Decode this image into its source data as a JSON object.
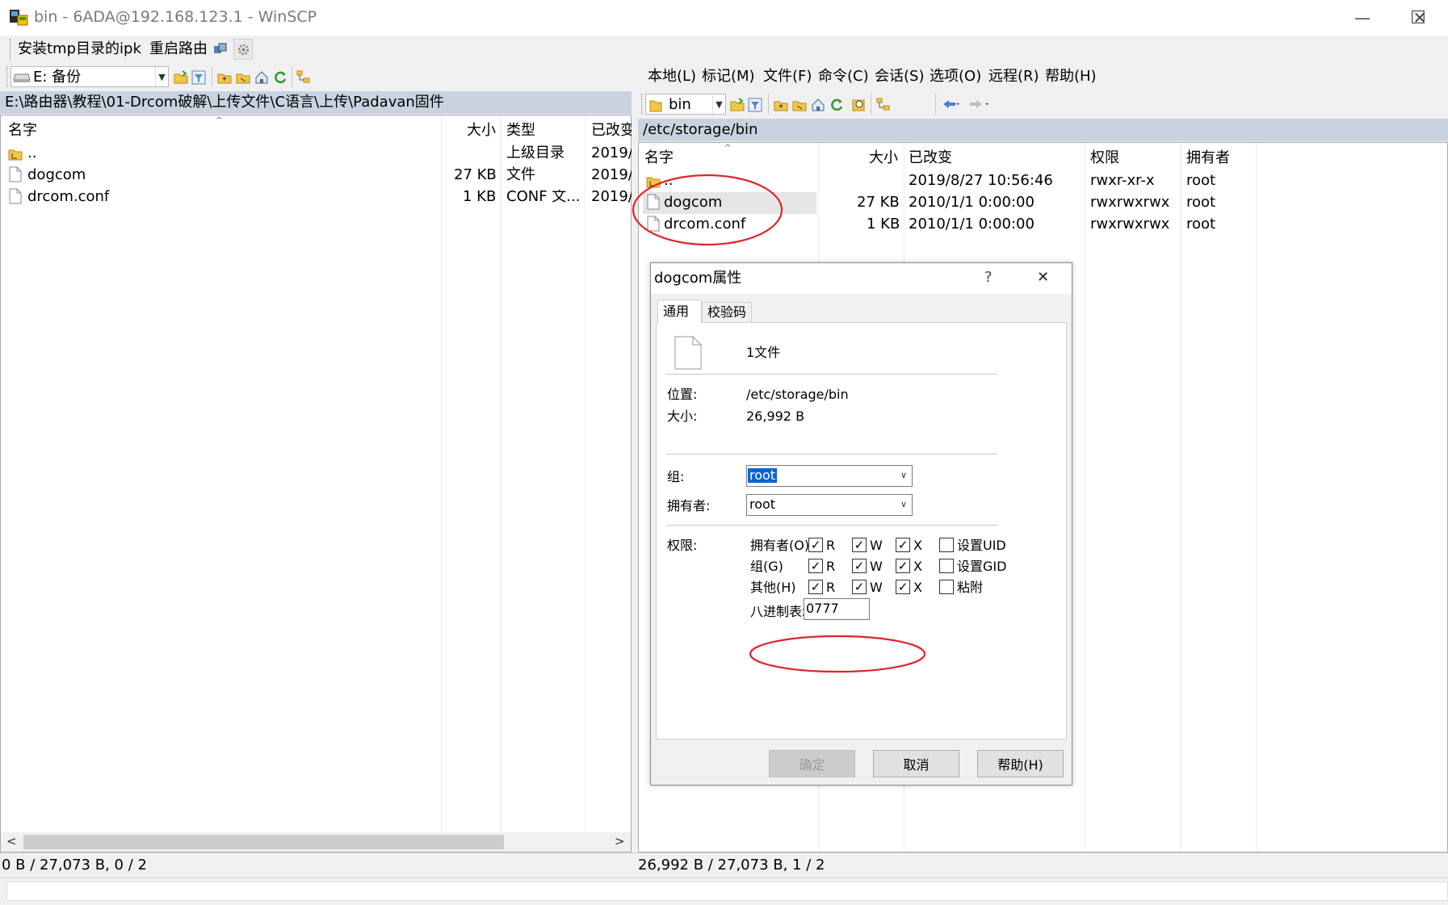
{
  "window": {
    "title": "bin - 6ADA@192.168.123.1 - WinSCP",
    "minimize": "—",
    "maximize": "☐",
    "close": "✕"
  },
  "custom_commands": {
    "cmd1": "安装tmp目录的ipk",
    "cmd2": "重启路由"
  },
  "local": {
    "drive": "E: 备份",
    "path": "E:\\路由器\\教程\\01-Drcom破解\\上传文件\\C语言\\上传\\Padavan固件",
    "columns": [
      "名字",
      "大小",
      "类型",
      "已改变"
    ],
    "rows": [
      {
        "name": "..",
        "size": "",
        "type": "上级目录",
        "changed": "2019/"
      },
      {
        "name": "dogcom",
        "size": "27 KB",
        "type": "文件",
        "changed": "2019/"
      },
      {
        "name": "drcom.conf",
        "size": "1 KB",
        "type": "CONF 文...",
        "changed": "2019/"
      }
    ],
    "status": "0 B / 27,073 B,   0 / 2"
  },
  "remote": {
    "menu": [
      "本地(L)",
      "标记(M)",
      "文件(F)",
      "命令(C)",
      "会话(S)",
      "选项(O)",
      "远程(R)",
      "帮助(H)"
    ],
    "folder": "bin",
    "path": "/etc/storage/bin",
    "columns": [
      "名字",
      "大小",
      "已改变",
      "权限",
      "拥有者"
    ],
    "rows": [
      {
        "name": "..",
        "size": "",
        "changed": "2019/8/27 10:56:46",
        "rights": "rwxr-xr-x",
        "owner": "root"
      },
      {
        "name": "dogcom",
        "size": "27 KB",
        "changed": "2010/1/1 0:00:00",
        "rights": "rwxrwxrwx",
        "owner": "root"
      },
      {
        "name": "drcom.conf",
        "size": "1 KB",
        "changed": "2010/1/1 0:00:00",
        "rights": "rwxrwxrwx",
        "owner": "root"
      }
    ],
    "status": "26,992 B / 27,073 B,   1 / 2"
  },
  "dialog": {
    "title": "dogcom属性",
    "help_glyph": "?",
    "close_glyph": "✕",
    "tabs": [
      "通用",
      "校验码"
    ],
    "file_count": "1文件",
    "location_label": "位置:",
    "location": "/etc/storage/bin",
    "size_label": "大小:",
    "size": "26,992 B",
    "group_label": "组:",
    "group": "root",
    "owner_label": "拥有者:",
    "owner": "root",
    "perm_label": "权限:",
    "perm_rows": [
      {
        "label": "拥有者(O)",
        "r": true,
        "w": true,
        "x": true,
        "special": "设置UID",
        "special_checked": false
      },
      {
        "label": "组(G)",
        "r": true,
        "w": true,
        "x": true,
        "special": "设置GID",
        "special_checked": false
      },
      {
        "label": "其他(H)",
        "r": true,
        "w": true,
        "x": true,
        "special": "粘附",
        "special_checked": false
      }
    ],
    "letters": {
      "r": "R",
      "w": "W",
      "x": "X"
    },
    "octal_label": "八进制表示",
    "octal": "0777",
    "ok": "确定",
    "cancel": "取消",
    "help": "帮助(H)"
  },
  "annotation_color": "#e0242a",
  "selection_color": "#0a64d6",
  "path_bar_color": "#c9d3df"
}
